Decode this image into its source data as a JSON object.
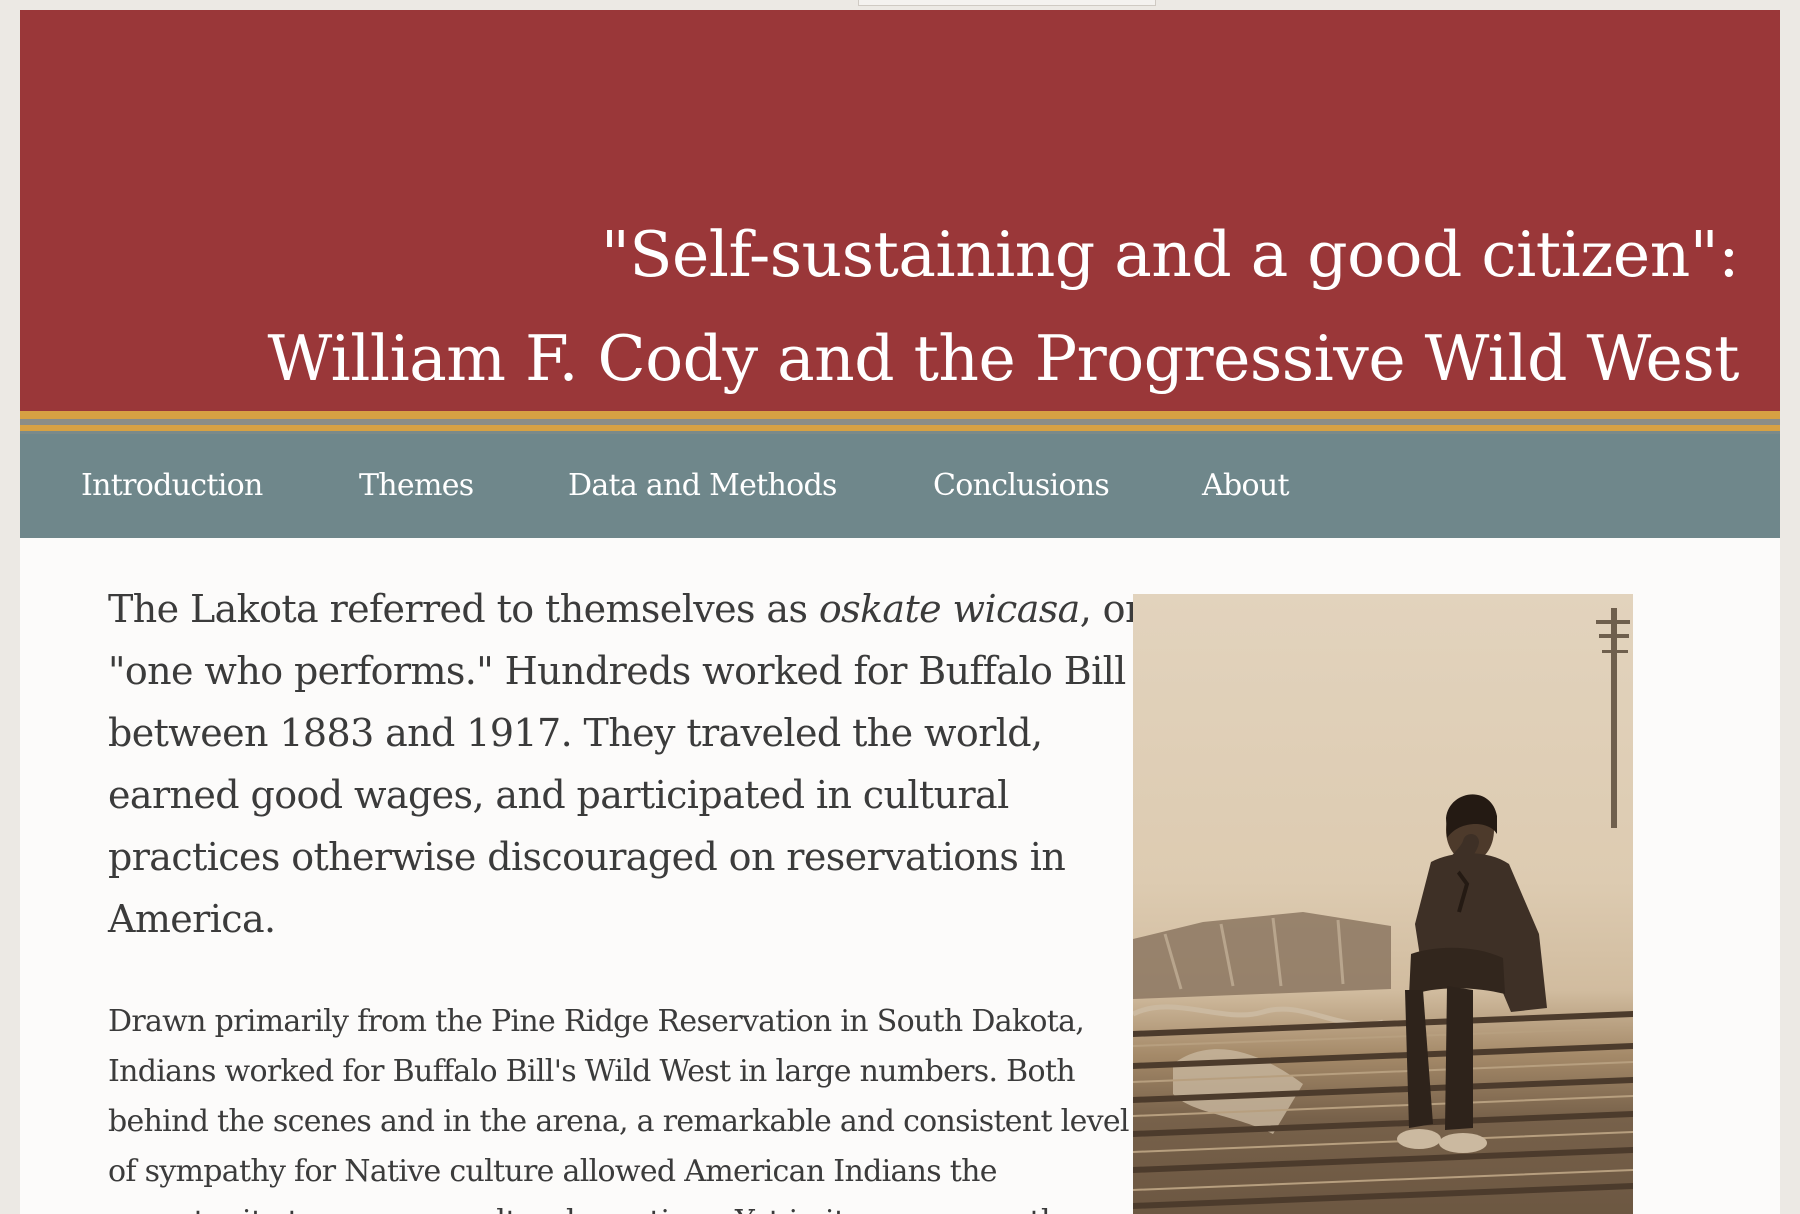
{
  "header": {
    "title_line1": "\"Self-sustaining and a good citizen\":",
    "title_line2": "William F. Cody and the Progressive Wild West",
    "background_color": "#9a3739",
    "stripe_color": "#d7a143"
  },
  "nav": {
    "background_color": "#6f878b",
    "items": [
      {
        "label": "Introduction"
      },
      {
        "label": "Themes"
      },
      {
        "label": "Data and Methods"
      },
      {
        "label": "Conclusions"
      },
      {
        "label": "About"
      }
    ]
  },
  "main": {
    "lede": {
      "line1_before": "The Lakota referred to themselves as ",
      "line1_italic": "oskate wicasa",
      "line1_after": ", or",
      "line2": "\"one who performs.\" Hundreds worked for Buffalo Bill",
      "line3": "between 1883 and 1917. They traveled the world,",
      "line4": "earned good wages, and participated in cultural",
      "line5": "practices otherwise discouraged on reservations in",
      "line6": "America."
    },
    "body": {
      "line1": "Drawn primarily from the Pine Ridge Reservation in South Dakota,",
      "line2": "Indians worked for Buffalo Bill's Wild West in large numbers. Both",
      "line3": "behind the scenes and in the arena, a remarkable and consistent level",
      "line4": "of sympathy for Native culture allowed American Indians the",
      "line5": "opportunity to preserve cultural practices. Yet in its own ways, the"
    },
    "photo": {
      "icon": "sepia-photograph"
    }
  }
}
